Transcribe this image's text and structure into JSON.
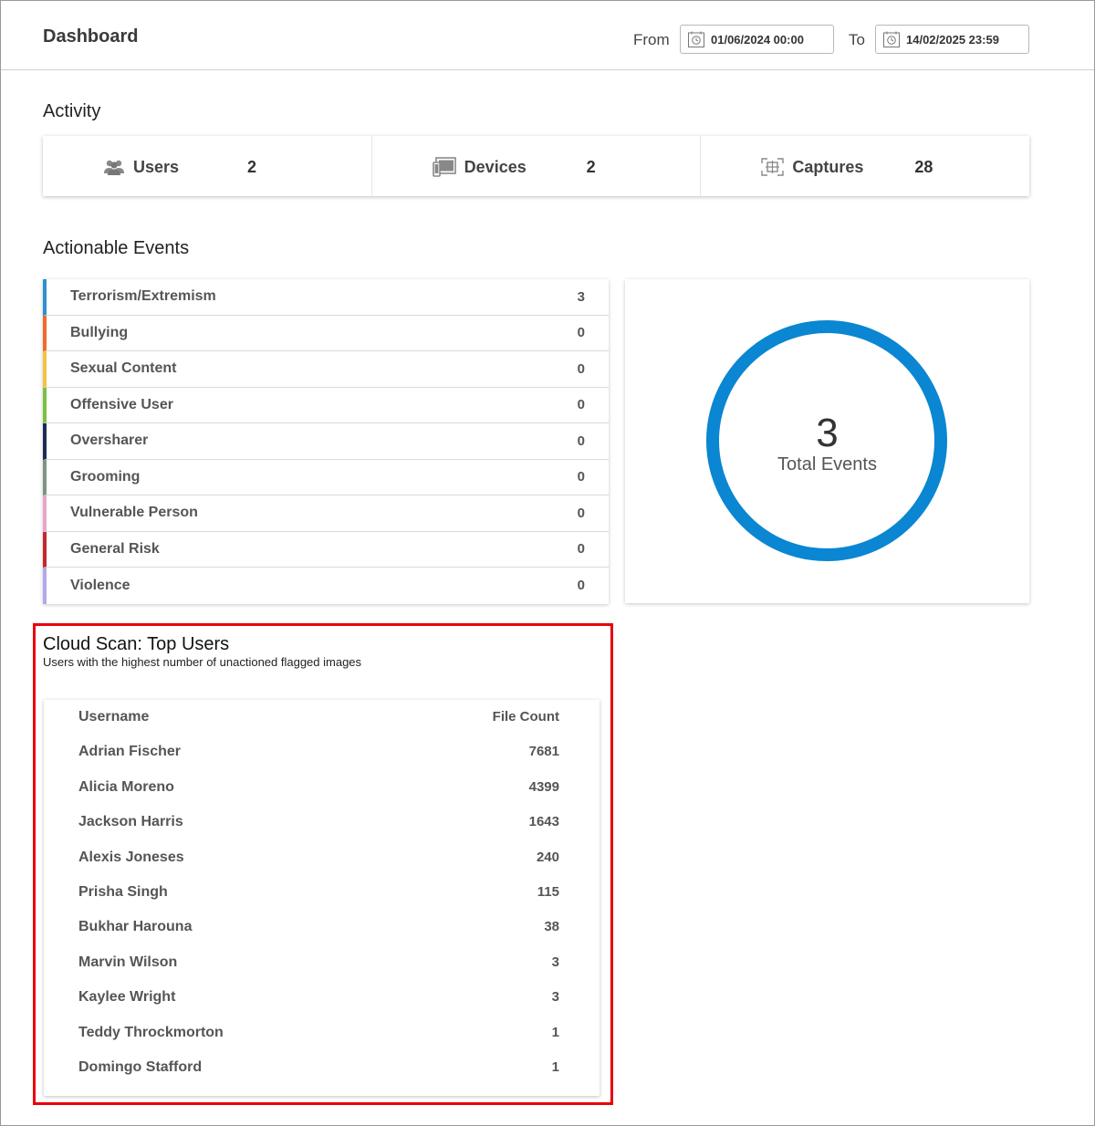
{
  "header": {
    "title": "Dashboard",
    "from_label": "From",
    "from_value": "01/06/2024 00:00",
    "to_label": "To",
    "to_value": "14/02/2025 23:59"
  },
  "activity": {
    "title": "Activity",
    "items": [
      {
        "label": "Users",
        "count": "2",
        "icon": "users-icon"
      },
      {
        "label": "Devices",
        "count": "2",
        "icon": "devices-icon"
      },
      {
        "label": "Captures",
        "count": "28",
        "icon": "captures-icon"
      }
    ]
  },
  "events": {
    "title": "Actionable Events",
    "items": [
      {
        "name": "Terrorism/Extremism",
        "count": "3",
        "color": "#2f8fd1"
      },
      {
        "name": "Bullying",
        "count": "0",
        "color": "#f06a2c"
      },
      {
        "name": "Sexual Content",
        "count": "0",
        "color": "#f5c242"
      },
      {
        "name": "Offensive User",
        "count": "0",
        "color": "#7ac142"
      },
      {
        "name": "Oversharer",
        "count": "0",
        "color": "#1c2a55"
      },
      {
        "name": "Grooming",
        "count": "0",
        "color": "#7d9580"
      },
      {
        "name": "Vulnerable Person",
        "count": "0",
        "color": "#e6a6c9"
      },
      {
        "name": "General Risk",
        "count": "0",
        "color": "#c4262e"
      },
      {
        "name": "Violence",
        "count": "0",
        "color": "#b5a8ea"
      }
    ],
    "total": "3",
    "total_label": "Total Events",
    "ring_color": "#0a86d2"
  },
  "cloud_scan": {
    "title": "Cloud Scan: Top Users",
    "subtitle": "Users with the highest number of unactioned flagged images",
    "columns": [
      "Username",
      "File Count"
    ],
    "rows": [
      {
        "username": "Adrian Fischer",
        "count": "7681"
      },
      {
        "username": "Alicia Moreno",
        "count": "4399"
      },
      {
        "username": "Jackson Harris",
        "count": "1643"
      },
      {
        "username": "Alexis Joneses",
        "count": "240"
      },
      {
        "username": "Prisha Singh",
        "count": "115"
      },
      {
        "username": "Bukhar Harouna",
        "count": "38"
      },
      {
        "username": "Marvin Wilson",
        "count": "3"
      },
      {
        "username": "Kaylee Wright",
        "count": "3"
      },
      {
        "username": "Teddy Throckmorton",
        "count": "1"
      },
      {
        "username": "Domingo Stafford",
        "count": "1"
      }
    ],
    "highlight_color": "#e8000b"
  }
}
